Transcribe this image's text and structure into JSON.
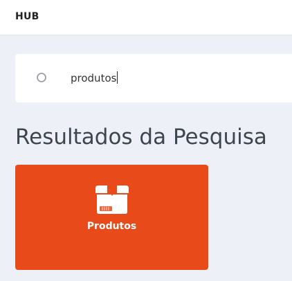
{
  "header": {
    "title": "HUB"
  },
  "search": {
    "value": "produtos",
    "icon": "search-icon"
  },
  "results": {
    "heading": "Resultados da Pesquisa",
    "items": [
      {
        "label": "Produtos",
        "icon": "box-icon",
        "color": "#e84a1a"
      }
    ]
  }
}
